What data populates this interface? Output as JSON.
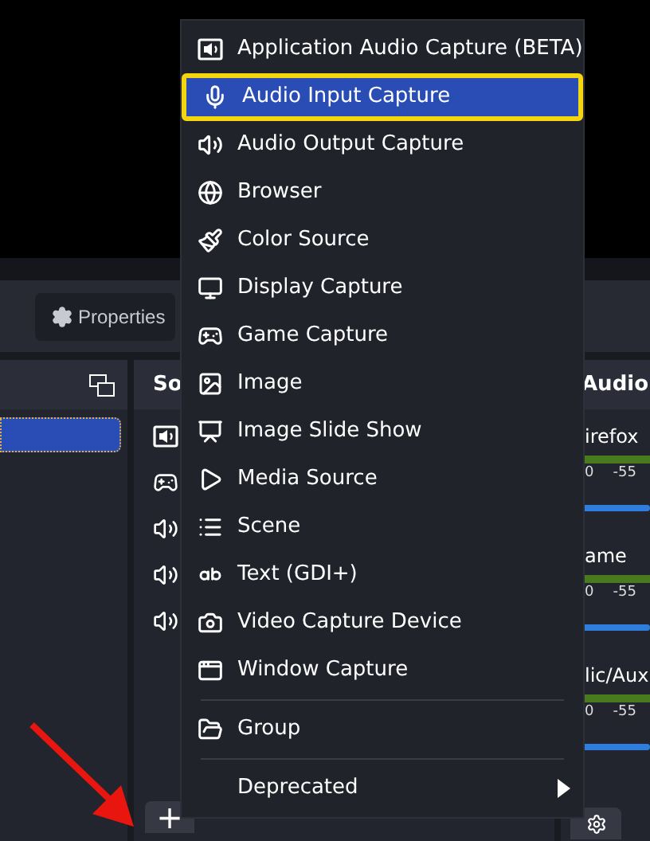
{
  "toolbar": {
    "properties_button": "Properties"
  },
  "scenes_panel": {
    "rows": [
      {
        "selected": true
      }
    ]
  },
  "sources_panel": {
    "title": "So",
    "add_button": "+"
  },
  "audio_mixer": {
    "title": "Audio",
    "channels": [
      {
        "name": "irefox",
        "scale": [
          "0",
          "-55"
        ],
        "level": 1
      },
      {
        "name": "ame",
        "scale": [
          "0",
          "-55"
        ],
        "level": 1
      },
      {
        "name": "lic/Aux",
        "scale": [
          "0",
          "-55"
        ],
        "level": 1
      }
    ]
  },
  "context_menu": {
    "items": [
      {
        "kind": "item",
        "label": "Application Audio Capture (BETA)",
        "selected": false
      },
      {
        "kind": "item",
        "label": "Audio Input Capture",
        "selected": true
      },
      {
        "kind": "item",
        "label": "Audio Output Capture",
        "selected": false
      },
      {
        "kind": "item",
        "label": "Browser",
        "selected": false
      },
      {
        "kind": "item",
        "label": "Color Source",
        "selected": false
      },
      {
        "kind": "item",
        "label": "Display Capture",
        "selected": false
      },
      {
        "kind": "item",
        "label": "Game Capture",
        "selected": false
      },
      {
        "kind": "item",
        "label": "Image",
        "selected": false
      },
      {
        "kind": "item",
        "label": "Image Slide Show",
        "selected": false
      },
      {
        "kind": "item",
        "label": "Media Source",
        "selected": false
      },
      {
        "kind": "item",
        "label": "Scene",
        "selected": false
      },
      {
        "kind": "item",
        "label": "Text (GDI+)",
        "selected": false
      },
      {
        "kind": "item",
        "label": "Video Capture Device",
        "selected": false
      },
      {
        "kind": "item",
        "label": "Window Capture",
        "selected": false
      },
      {
        "kind": "separator"
      },
      {
        "kind": "item",
        "label": "Group",
        "selected": false
      },
      {
        "kind": "separator"
      },
      {
        "kind": "submenu",
        "label": "Deprecated",
        "selected": false
      }
    ]
  }
}
